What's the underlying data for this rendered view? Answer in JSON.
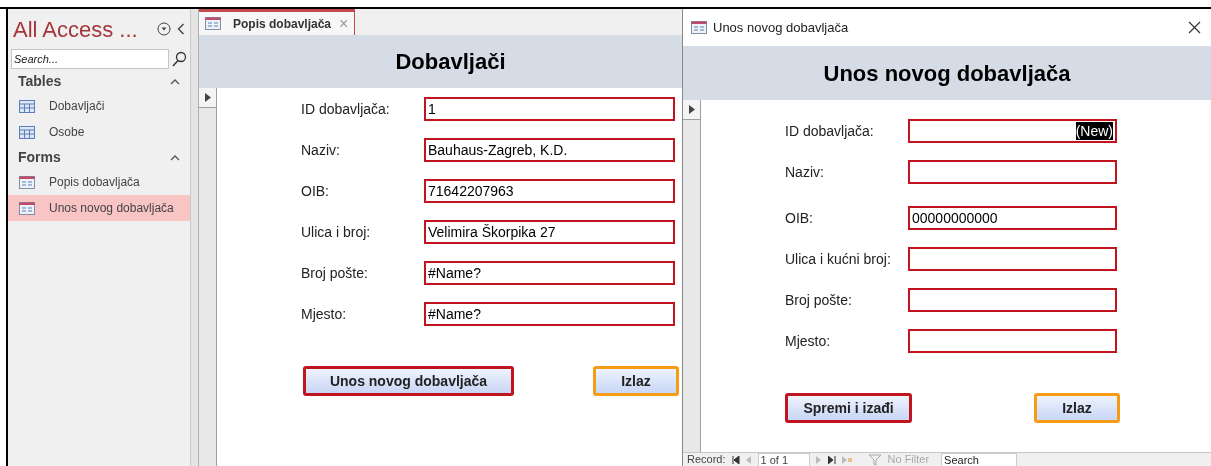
{
  "nav_pane": {
    "title": "All Access ...",
    "search": {
      "placeholder": "Search..."
    },
    "groups": [
      {
        "label": "Tables",
        "expanded": true,
        "items": [
          {
            "label": "Dobavljači",
            "kind": "table",
            "selected": false
          },
          {
            "label": "Osobe",
            "kind": "table",
            "selected": false
          }
        ]
      },
      {
        "label": "Forms",
        "expanded": true,
        "items": [
          {
            "label": "Popis dobavljača",
            "kind": "form",
            "selected": false
          },
          {
            "label": "Unos novog dobavljača",
            "kind": "form",
            "selected": true
          }
        ]
      }
    ]
  },
  "document_tab": {
    "label": "Popis dobavljača",
    "close": "×"
  },
  "list_form": {
    "header": "Dobavljači",
    "fields": [
      {
        "label": "ID dobavljača:",
        "value": "1"
      },
      {
        "label": "Naziv:",
        "value": "Bauhaus-Zagreb, K.D."
      },
      {
        "label": "OIB:",
        "value": "71642207963"
      },
      {
        "label": "Ulica i broj:",
        "value": "Velimira Škorpika 27"
      },
      {
        "label": "Broj pošte:",
        "value": "#Name?"
      },
      {
        "label": "Mjesto:",
        "value": "#Name?"
      }
    ],
    "buttons": [
      {
        "label": "Unos novog dobavljača",
        "color": "#c0141f"
      },
      {
        "label": "Izlaz",
        "color": "#f59b16"
      }
    ]
  },
  "popup": {
    "title": "Unos novog dobavljača",
    "header": "Unos novog dobavljača",
    "fields": [
      {
        "label": "ID dobavljača:",
        "value": "(New)",
        "highlighted": true
      },
      {
        "label": "Naziv:"
      },
      {
        "label": "OIB:",
        "value": "00000000000"
      },
      {
        "label": "Ulica i kućni broj:"
      },
      {
        "label": "Broj pošte:"
      },
      {
        "label": "Mjesto:"
      }
    ],
    "buttons": [
      {
        "label": "Spremi i izađi",
        "color": "#c0141f"
      },
      {
        "label": "Izlaz",
        "color": "#f59b16"
      }
    ],
    "record_nav": {
      "label": "Record:",
      "position": "1 of 1",
      "filter": "No Filter",
      "search": {
        "placeholder": "Search"
      }
    }
  }
}
